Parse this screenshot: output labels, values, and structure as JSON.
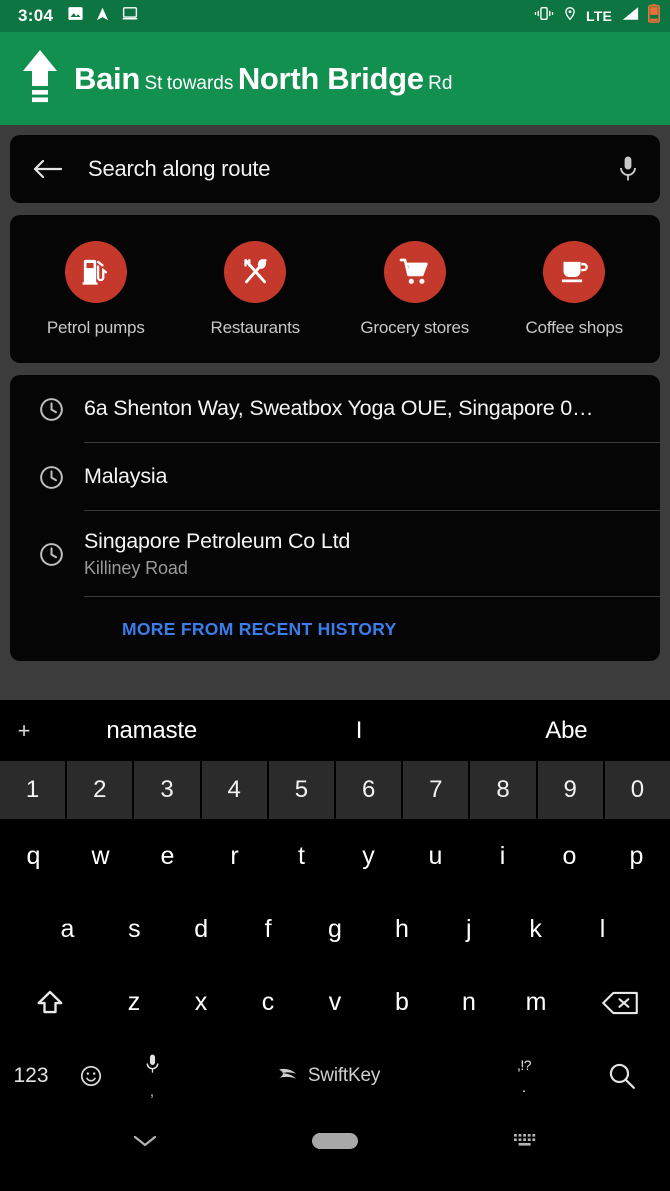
{
  "status_bar": {
    "time": "3:04",
    "left_icons": [
      "image-icon",
      "navigation-arrow-icon",
      "cast-screen-icon"
    ],
    "network_label": "LTE",
    "right_icons": [
      "vibrate-icon",
      "location-pin-icon",
      "signal-bars-icon",
      "battery-charging-icon"
    ],
    "background_color": "#0d7541"
  },
  "nav_header": {
    "maneuver_icon": "straight-ahead-arrow-icon",
    "street_primary": "Bain",
    "street_primary_suffix": "St",
    "connector": "towards",
    "street_secondary": "North Bridge",
    "street_secondary_suffix": "Rd",
    "background_color": "#129050"
  },
  "search": {
    "back_icon": "back-arrow-icon",
    "placeholder": "Search along route",
    "mic_icon": "microphone-icon"
  },
  "categories": [
    {
      "label": "Petrol pumps",
      "icon": "fuel-pump-icon",
      "color": "#c5392c"
    },
    {
      "label": "Restaurants",
      "icon": "fork-spoon-icon",
      "color": "#c5392c"
    },
    {
      "label": "Grocery stores",
      "icon": "shopping-cart-icon",
      "color": "#c5392c"
    },
    {
      "label": "Coffee shops",
      "icon": "coffee-cup-icon",
      "color": "#c5392c"
    }
  ],
  "recent_history": {
    "items": [
      {
        "icon": "clock-icon",
        "title": "6a Shenton Way, Sweatbox Yoga OUE, Singapore 0…",
        "subtitle": ""
      },
      {
        "icon": "clock-icon",
        "title": "Malaysia",
        "subtitle": ""
      },
      {
        "icon": "clock-icon",
        "title": "Singapore Petroleum Co Ltd",
        "subtitle": "Killiney Road"
      }
    ],
    "more_label": "MORE FROM RECENT HISTORY",
    "more_color": "#3b7ded"
  },
  "keyboard": {
    "suggestion_plus": "+",
    "suggestions": [
      "namaste",
      "I",
      "Abe"
    ],
    "number_row": [
      "1",
      "2",
      "3",
      "4",
      "5",
      "6",
      "7",
      "8",
      "9",
      "0"
    ],
    "row1": [
      "q",
      "w",
      "e",
      "r",
      "t",
      "y",
      "u",
      "i",
      "o",
      "p"
    ],
    "row2": [
      "a",
      "s",
      "d",
      "f",
      "g",
      "h",
      "j",
      "k",
      "l"
    ],
    "row3": [
      "z",
      "x",
      "c",
      "v",
      "b",
      "n",
      "m"
    ],
    "shift_icon": "shift-icon",
    "backspace_icon": "backspace-icon",
    "function_row": {
      "numeric_label": "123",
      "emoji_icon": "emoji-icon",
      "mic_icon": "microphone-icon",
      "comma_label": ",",
      "brand": "SwiftKey",
      "brand_icon": "swiftkey-logo-icon",
      "punct_top_label": ",!?",
      "punct_dot_label": ".",
      "search_icon": "search-icon"
    }
  },
  "navigation_bar": {
    "hide_keyboard_icon": "chevron-down-icon",
    "home_icon": "home-pill-icon",
    "keyboard_switch_icon": "keyboard-icon"
  }
}
